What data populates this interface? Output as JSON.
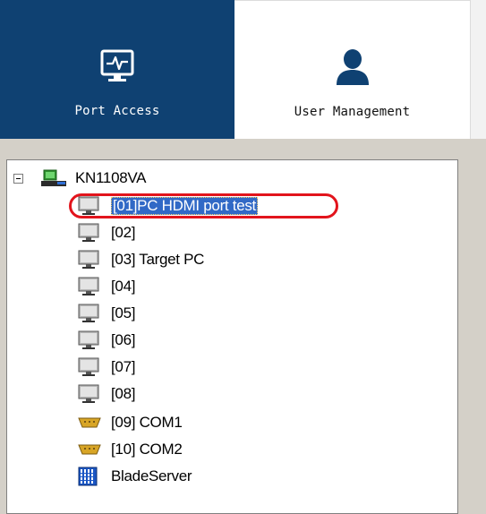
{
  "tabs": [
    {
      "label": "Port Access",
      "icon": "monitor-pulse-icon",
      "active": true
    },
    {
      "label": "User Management",
      "icon": "user-icon",
      "active": false
    }
  ],
  "tree": {
    "root": {
      "label": "KN1108VA",
      "icon": "kvm-switch-icon",
      "expanded": true
    },
    "items": [
      {
        "label": "[01]PC HDMI port test",
        "icon": "monitor-icon",
        "selected": true
      },
      {
        "label": "[02]",
        "icon": "monitor-icon"
      },
      {
        "label": "[03] Target PC",
        "icon": "monitor-icon"
      },
      {
        "label": "[04]",
        "icon": "monitor-icon"
      },
      {
        "label": "[05]",
        "icon": "monitor-icon"
      },
      {
        "label": "[06]",
        "icon": "monitor-icon"
      },
      {
        "label": "[07]",
        "icon": "monitor-icon"
      },
      {
        "label": "[08]",
        "icon": "monitor-icon"
      },
      {
        "label": "[09] COM1",
        "icon": "serial-port-icon"
      },
      {
        "label": "[10] COM2",
        "icon": "serial-port-icon"
      },
      {
        "label": "BladeServer",
        "icon": "blade-server-icon"
      }
    ]
  },
  "colors": {
    "active_tab": "#0f4172",
    "selection": "#3169c6",
    "highlight_ring": "#e2141c"
  }
}
